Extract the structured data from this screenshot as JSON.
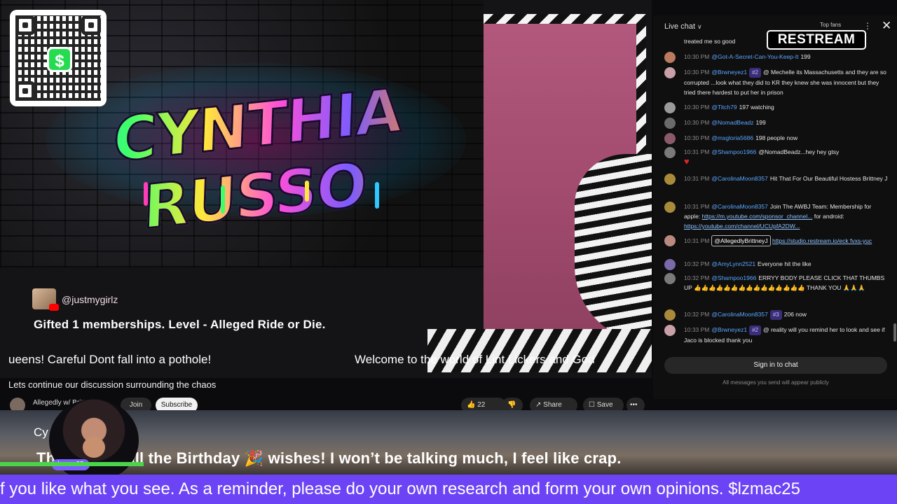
{
  "stream": {
    "graffiti_title": "CYNTHIA RUSSO",
    "cashapp_symbol": "$",
    "alert": {
      "username": "@justmygirlz",
      "message": "Gifted 1 memberships. Level - Alleged Ride or Die."
    },
    "ticker_left": "ueens!  Careful Dont fall into a pothole!",
    "ticker_right": "Welcome to the world of Lint Lickers and God"
  },
  "video": {
    "title": "Lets continue our discussion surrounding the chaos",
    "channel": "Allegedly w/ Britt...",
    "join": "Join",
    "subscribe": "Subscribe",
    "likes": "22",
    "share": "Share",
    "save": "Save",
    "more": "•••"
  },
  "chat": {
    "title": "Live chat",
    "top_fans": "Top fans",
    "restream_logo": "RESTREAM",
    "messages": [
      {
        "time": "",
        "author": "",
        "badge": "",
        "text": "treated me so good",
        "avatar_color": "#444"
      },
      {
        "time": "10:30 PM",
        "author": "@Got-A-Secret-Can-You-Keep-It",
        "badge": "",
        "text": "199",
        "avatar_color": "#b97a5d"
      },
      {
        "time": "10:30 PM",
        "author": "@Brwneyez1",
        "badge": "#2",
        "text": "@ Mechelle its Massachusetts and they are so corrupted ...look what they did to KR they knew she was innocent but they tried there hardest to put her in prison",
        "avatar_color": "#c9a0a8"
      },
      {
        "time": "10:30 PM",
        "author": "@Titch79",
        "badge": "",
        "text": "197 watching",
        "avatar_color": "#9a9a9a"
      },
      {
        "time": "10:30 PM",
        "author": "@NomadBeadz",
        "badge": "",
        "text": "199",
        "avatar_color": "#6a6a6a"
      },
      {
        "time": "10:30 PM",
        "author": "@msgloria5686",
        "badge": "",
        "text": "198 people now",
        "avatar_color": "#8a5a6a"
      },
      {
        "time": "10:31 PM",
        "author": "@Shampoo1966",
        "badge": "",
        "text": "@NomadBeadz...hey hey gtsy",
        "avatar_color": "#7a7a7a"
      },
      {
        "time": "10:31 PM",
        "author": "@CarolinaMoon8357",
        "badge": "",
        "text": "Hit That  For Our Beautiful Hostess Brittney J",
        "avatar_color": "#a88a3a"
      },
      {
        "time": "10:31 PM",
        "author": "@CarolinaMoon8357",
        "badge": "",
        "text": "Join The AWBJ Team: Membership for apple:",
        "link": "https://m.youtube.com/sponsor_channel...",
        "text2": " for android:",
        "link2": "https://youtube.com/channel/UCUpfA2DW...",
        "avatar_color": "#a88a3a"
      },
      {
        "time": "10:31 PM",
        "author": "",
        "badge": "",
        "mention": "@AllegedlyBrittneyJ",
        "text": "",
        "link": "https://studio.restream.io/eck fvxs-yuc",
        "avatar_color": "#b88a80"
      },
      {
        "time": "10:32 PM",
        "author": "@AmyLynn2521",
        "badge": "",
        "text": "Everyone hit the like",
        "avatar_color": "#7a6aa8"
      },
      {
        "time": "10:32 PM",
        "author": "@Shampoo1966",
        "badge": "",
        "text": "ERRYY BODY PLEASE CLICK THAT THUMBS UP 👍👍👍👍👍👍👍👍👍👍👍👍👍👍👍 THANK YOU 🙏🙏🙏",
        "avatar_color": "#7a7a7a"
      },
      {
        "time": "10:32 PM",
        "author": "@CarolinaMoon8357",
        "badge": "#3",
        "text": "206 now",
        "avatar_color": "#a88a3a"
      },
      {
        "time": "10:33 PM",
        "author": "@Brwneyez1",
        "badge": "#2",
        "text": "@ reality will you remind her to look and see if Jaco is blocked thank you",
        "avatar_color": "#c9a0a8"
      }
    ],
    "signin_button": "Sign in to chat",
    "signin_note": "All messages you send will appear publicly"
  },
  "overlay": {
    "channel_name": "Cy          usso",
    "message": "Th           yone for all the Birthday 🎉 wishes! I won’t be talking much, I feel like crap.",
    "host_badge": "lzmac25",
    "progress_fraction": 0.16,
    "progress_color": "#4ad44a",
    "bottom_ticker": "f you like what you see. As a reminder, please do your own research and form your own opinions. $lzmac25",
    "ticker_color": "#6d44f5"
  }
}
